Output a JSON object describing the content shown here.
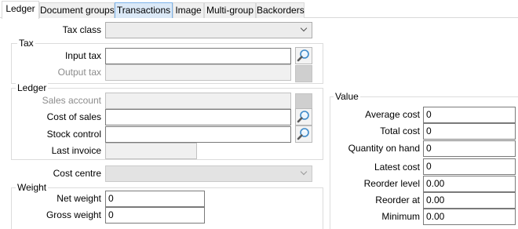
{
  "tabs": [
    "Ledger",
    "Document groups",
    "Transactions",
    "Image",
    "Multi-group",
    "Backorders"
  ],
  "ledger_tab": {
    "tax_class_label": "Tax class",
    "tax_class_value": "",
    "tax_group_title": "Tax",
    "input_tax_label": "Input tax",
    "input_tax_value": "",
    "output_tax_label": "Output tax",
    "output_tax_value": "",
    "ledger_group_title": "Ledger",
    "sales_account_label": "Sales account",
    "sales_account_value": "",
    "cost_of_sales_label": "Cost of sales",
    "cost_of_sales_value": "",
    "stock_control_label": "Stock control",
    "stock_control_value": "",
    "last_invoice_label": "Last invoice",
    "last_invoice_value": "",
    "cost_centre_label": "Cost centre",
    "cost_centre_value": "",
    "weight_group_title": "Weight",
    "net_weight_label": "Net weight",
    "net_weight_value": "0",
    "gross_weight_label": "Gross weight",
    "gross_weight_value": "0"
  },
  "value_group": {
    "title": "Value",
    "rows": [
      {
        "label": "Average cost",
        "value": "0"
      },
      {
        "label": "Total cost",
        "value": "0"
      },
      {
        "label": "Quantity on hand",
        "value": "0"
      },
      {
        "label": "Latest cost",
        "value": "0"
      },
      {
        "label": "Reorder level",
        "value": "0.00"
      },
      {
        "label": "Reorder at",
        "value": "0.00"
      },
      {
        "label": "Minimum",
        "value": "0.00"
      }
    ]
  },
  "icons": {
    "lookup": "magnifier-icon",
    "dropdown": "chevron-down-icon"
  },
  "colors": {
    "active_tab_hover": "#dbe9f7",
    "disabled_field": "#f0f0f0"
  }
}
